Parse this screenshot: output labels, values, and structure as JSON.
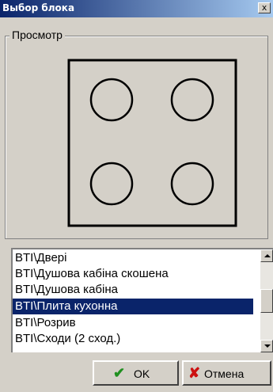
{
  "window": {
    "title": "Выбор блока",
    "close_glyph": "x"
  },
  "preview_group": {
    "label": "Просмотр"
  },
  "block_list": {
    "items": [
      {
        "label": "BTI\\Двері",
        "selected": false
      },
      {
        "label": "BTI\\Душова кабіна скошена",
        "selected": false
      },
      {
        "label": "BTI\\Душова кабіна",
        "selected": false
      },
      {
        "label": "BTI\\Плита кухонна",
        "selected": true
      },
      {
        "label": "BTI\\Розрив",
        "selected": false
      },
      {
        "label": "BTI\\Сходи (2 сход.)",
        "selected": false
      }
    ]
  },
  "buttons": {
    "ok_label": "OK",
    "ok_icon": "checkmark-icon",
    "cancel_label": "Отмена",
    "cancel_icon": "cross-icon"
  },
  "colors": {
    "selection": "#0a246a",
    "ok_icon": "#1f8f1f",
    "cancel_icon": "#cc1111"
  }
}
